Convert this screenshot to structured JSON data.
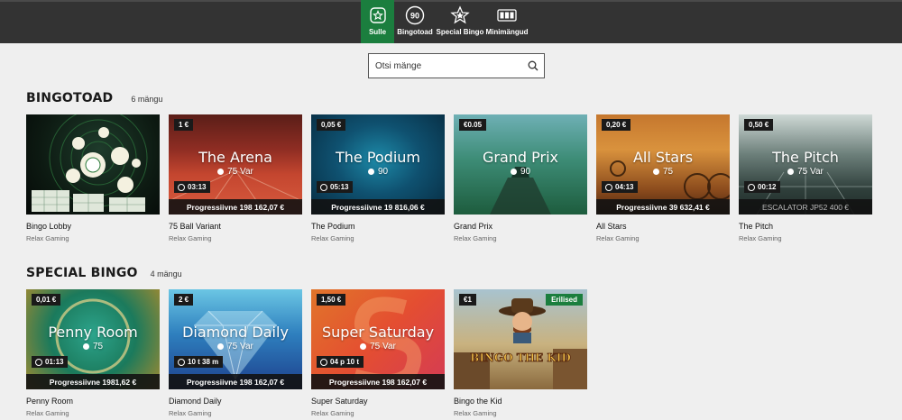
{
  "nav": {
    "items": [
      {
        "label": "Sulle",
        "icon": "star-badge-icon",
        "active": true
      },
      {
        "label": "Bingotoad",
        "icon": "ninety-ball-icon",
        "active": false
      },
      {
        "label": "Special Bingo",
        "icon": "special-star-icon",
        "active": false
      },
      {
        "label": "Minimängud",
        "icon": "slot-reels-icon",
        "active": false
      }
    ],
    "ninety_text": "90"
  },
  "search": {
    "placeholder": "Otsi mänge",
    "icon": "search-icon"
  },
  "sections": {
    "bingotoad": {
      "title": "BINGOTOAD",
      "count": "6 mängu"
    },
    "special": {
      "title": "SPECIAL BINGO",
      "count": "4 mängu"
    }
  },
  "bingotoad_games": [
    {
      "name": "Bingo Lobby",
      "provider": "Relax Gaming"
    },
    {
      "name": "75 Ball Variant",
      "provider": "Relax Gaming",
      "price": "1 €",
      "title": "The Arena",
      "sub": "75 Var",
      "timer": "03:13",
      "jackpot": "Progressiivne 198 162,07 €"
    },
    {
      "name": "The Podium",
      "provider": "Relax Gaming",
      "price": "0,05 €",
      "title": "The Podium",
      "sub": "90",
      "timer": "05:13",
      "jackpot": "Progressiivne 19 816,06 €"
    },
    {
      "name": "Grand Prix",
      "provider": "Relax Gaming",
      "price": "€0.05",
      "title": "Grand Prix",
      "sub": "90"
    },
    {
      "name": "All Stars",
      "provider": "Relax Gaming",
      "price": "0,20 €",
      "title": "All Stars",
      "sub": "75",
      "timer": "04:13",
      "jackpot": "Progressiivne 39 632,41 €"
    },
    {
      "name": "The Pitch",
      "provider": "Relax Gaming",
      "price": "0,50 €",
      "title": "The Pitch",
      "sub": "75 Var",
      "timer": "00:12",
      "jackpot": "ESCALATOR JP52 400 €"
    }
  ],
  "special_games": [
    {
      "name": "Penny Room",
      "provider": "Relax Gaming",
      "price": "0,01 €",
      "title": "Penny Room",
      "sub": "75",
      "timer": "01:13",
      "jackpot": "Progressiivne 1981,62 €"
    },
    {
      "name": "Diamond Daily",
      "provider": "Relax Gaming",
      "price": "2 €",
      "title": "Diamond Daily",
      "sub": "75 Var",
      "timer": "10 t 38 m",
      "jackpot": "Progressiivne 198 162,07 €"
    },
    {
      "name": "Super Saturday",
      "provider": "Relax Gaming",
      "price": "1,50 €",
      "title": "Super Saturday",
      "sub": "75 Var",
      "timer": "04 p 10 t",
      "jackpot": "Progressiivne 198 162,07 €"
    },
    {
      "name": "Bingo the Kid",
      "provider": "Relax Gaming",
      "price": "€1",
      "badge": "Erilised",
      "logo_text": "BINGO THE KID"
    }
  ],
  "colors": {
    "accent": "#1b7e3e",
    "topbar": "#333333",
    "background": "#efefef"
  }
}
